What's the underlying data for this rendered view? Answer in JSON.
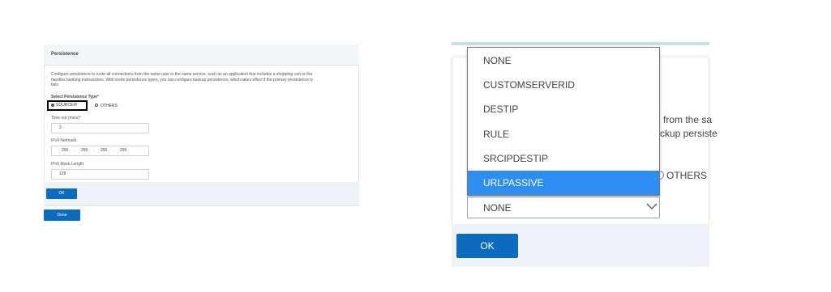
{
  "left": {
    "section_title": "Persistence",
    "description": "Configure persistence to route all connections from the same user to the same service, such as an application that includes a shopping cart or tha\nhandles banking transactions. With some persistence types, you can configure backup persistence, which takes effect if the primary persistence ty\nfails.",
    "select_type_label": "Select Persistence Type*",
    "radio_sourceip": "SOURCEIP",
    "radio_others": "OTHERS",
    "timeout_label": "Time-out (mins)*",
    "timeout_value": "2",
    "ipv4_label": "IPv4 Netmask",
    "ipv4_octets": [
      "255",
      "255",
      "255",
      "255"
    ],
    "ipv6_label": "IPv6 Mask Length",
    "ipv6_value": "128",
    "ok_label": "OK",
    "done_label": "Done"
  },
  "right": {
    "partial_line1": "from the sa",
    "partial_line2": "ckup persiste",
    "others_label": "OTHERS",
    "dropdown_options": [
      "NONE",
      "CUSTOMSERVERID",
      "DESTIP",
      "RULE",
      "SRCIPDESTIP",
      "URLPASSIVE"
    ],
    "highlighted_option": "URLPASSIVE",
    "selected_value": "NONE",
    "ok_label": "OK"
  },
  "colors": {
    "primary_button": "#0b6cbf",
    "highlight": "#2e8ff0"
  }
}
